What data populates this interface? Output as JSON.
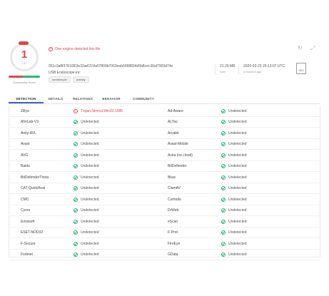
{
  "score": {
    "detections": "1",
    "total": "/ 57"
  },
  "community": {
    "label": "Community Score"
  },
  "alert": {
    "icon": "!",
    "text": "One engine detected this file"
  },
  "file": {
    "hash": "051c3a8f3781091fe32ad151fa07809b7063eab6098834d5b8cec36af7903d74e",
    "name": "USB Endoscope.inc",
    "tags": [
      "contains-pe",
      "overlay"
    ],
    "size_value": "21.29 MB",
    "size_label": "Size",
    "date_value": "2020-02-23 20:13:07 UTC",
    "date_label": "a moment ago",
    "type_label": "ISO"
  },
  "header_icons": [
    "refresh-icon",
    "expand-icon"
  ],
  "tabs": [
    "DETECTION",
    "DETAILS",
    "RELATIONS",
    "BEHAVIOR",
    "COMMUNITY"
  ],
  "rows": [
    {
      "e1": "Zillya",
      "r1": "Trojan.Nimnul.Win32.1585",
      "r1_bad": true,
      "e2": "Ad-Aware",
      "r2": "Undetected"
    },
    {
      "e1": "AhnLab-V3",
      "r1": "Undetected",
      "e2": "ALYac",
      "r2": "Undetected"
    },
    {
      "e1": "Antiy-AVL",
      "r1": "Undetected",
      "e2": "Arcabit",
      "r2": "Undetected"
    },
    {
      "e1": "Avast",
      "r1": "Undetected",
      "e2": "Avast-Mobile",
      "r2": "Undetected"
    },
    {
      "e1": "AVG",
      "r1": "Undetected",
      "e2": "Avira (no cloud)",
      "r2": "Undetected"
    },
    {
      "e1": "Baidu",
      "r1": "Undetected",
      "e2": "BitDefender",
      "r2": "Undetected"
    },
    {
      "e1": "BitDefenderTheta",
      "r1": "Undetected",
      "e2": "Bkav",
      "r2": "Undetected"
    },
    {
      "e1": "CAT-QuickHeal",
      "r1": "Undetected",
      "e2": "ClamAV",
      "r2": "Undetected"
    },
    {
      "e1": "CMC",
      "r1": "Undetected",
      "e2": "Comodo",
      "r2": "Undetected"
    },
    {
      "e1": "Cyren",
      "r1": "Undetected",
      "e2": "DrWeb",
      "r2": "Undetected"
    },
    {
      "e1": "Emsisoft",
      "r1": "Undetected",
      "e2": "eScan",
      "r2": "Undetected"
    },
    {
      "e1": "ESET-NOD32",
      "r1": "Undetected",
      "e2": "F-Prot",
      "r2": "Undetected"
    },
    {
      "e1": "F-Secure",
      "r1": "Undetected",
      "e2": "FireEye",
      "r2": "Undetected"
    },
    {
      "e1": "Fortinet",
      "r1": "Undetected",
      "e2": "GData",
      "r2": "Undetected"
    }
  ],
  "colors": {
    "danger": "#e8404b",
    "safe": "#2bb673",
    "accent": "#3a62c8"
  }
}
